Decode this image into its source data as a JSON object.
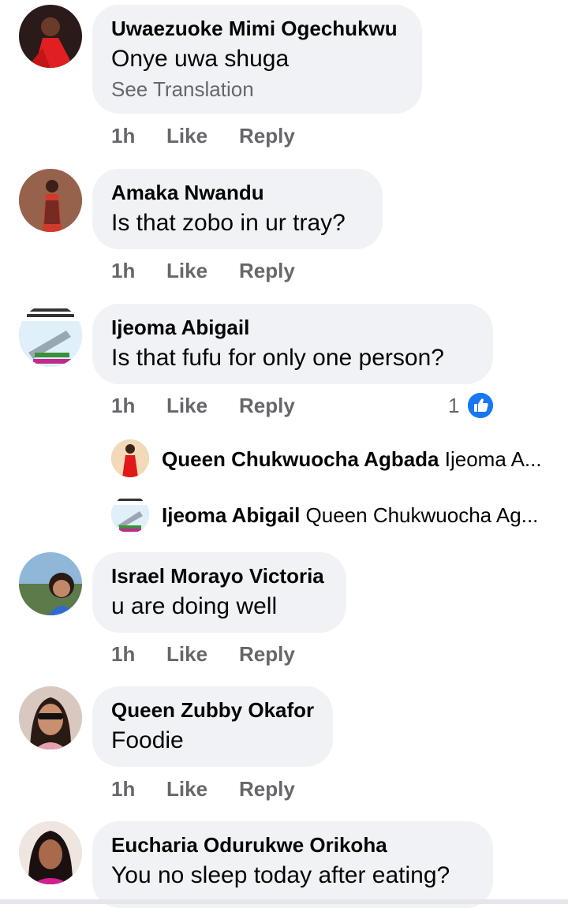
{
  "comments": [
    {
      "name": "Uwaezuoke Mimi Ogechukwu",
      "text": "Onye uwa shuga",
      "see_translation": "See Translation",
      "time": "1h",
      "like": "Like",
      "reply": "Reply"
    },
    {
      "name": "Amaka Nwandu",
      "text": "Is that zobo in ur tray?",
      "time": "1h",
      "like": "Like",
      "reply": "Reply"
    },
    {
      "name": "Ijeoma Abigail",
      "text": "Is that fufu for only one person?",
      "time": "1h",
      "like": "Like",
      "reply": "Reply",
      "reaction_count": "1",
      "replies": [
        {
          "name": "Queen Chukwuocha Agbada",
          "preview": "Ijeoma A..."
        },
        {
          "name": "Ijeoma Abigail",
          "preview": "Queen Chukwuocha Ag..."
        }
      ]
    },
    {
      "name": "Israel Morayo Victoria",
      "text": "u are doing well",
      "time": "1h",
      "like": "Like",
      "reply": "Reply"
    },
    {
      "name": "Queen Zubby Okafor",
      "text": "Foodie",
      "time": "1h",
      "like": "Like",
      "reply": "Reply"
    },
    {
      "name": "Eucharia Odurukwe Orikoha",
      "text": "You no sleep today after eating?"
    }
  ],
  "colors": {
    "like_blue": "#1877f2",
    "bubble_bg": "#f0f2f5",
    "meta_gray": "#65676b"
  },
  "icons": {
    "reaction": "like-thumb-icon"
  }
}
